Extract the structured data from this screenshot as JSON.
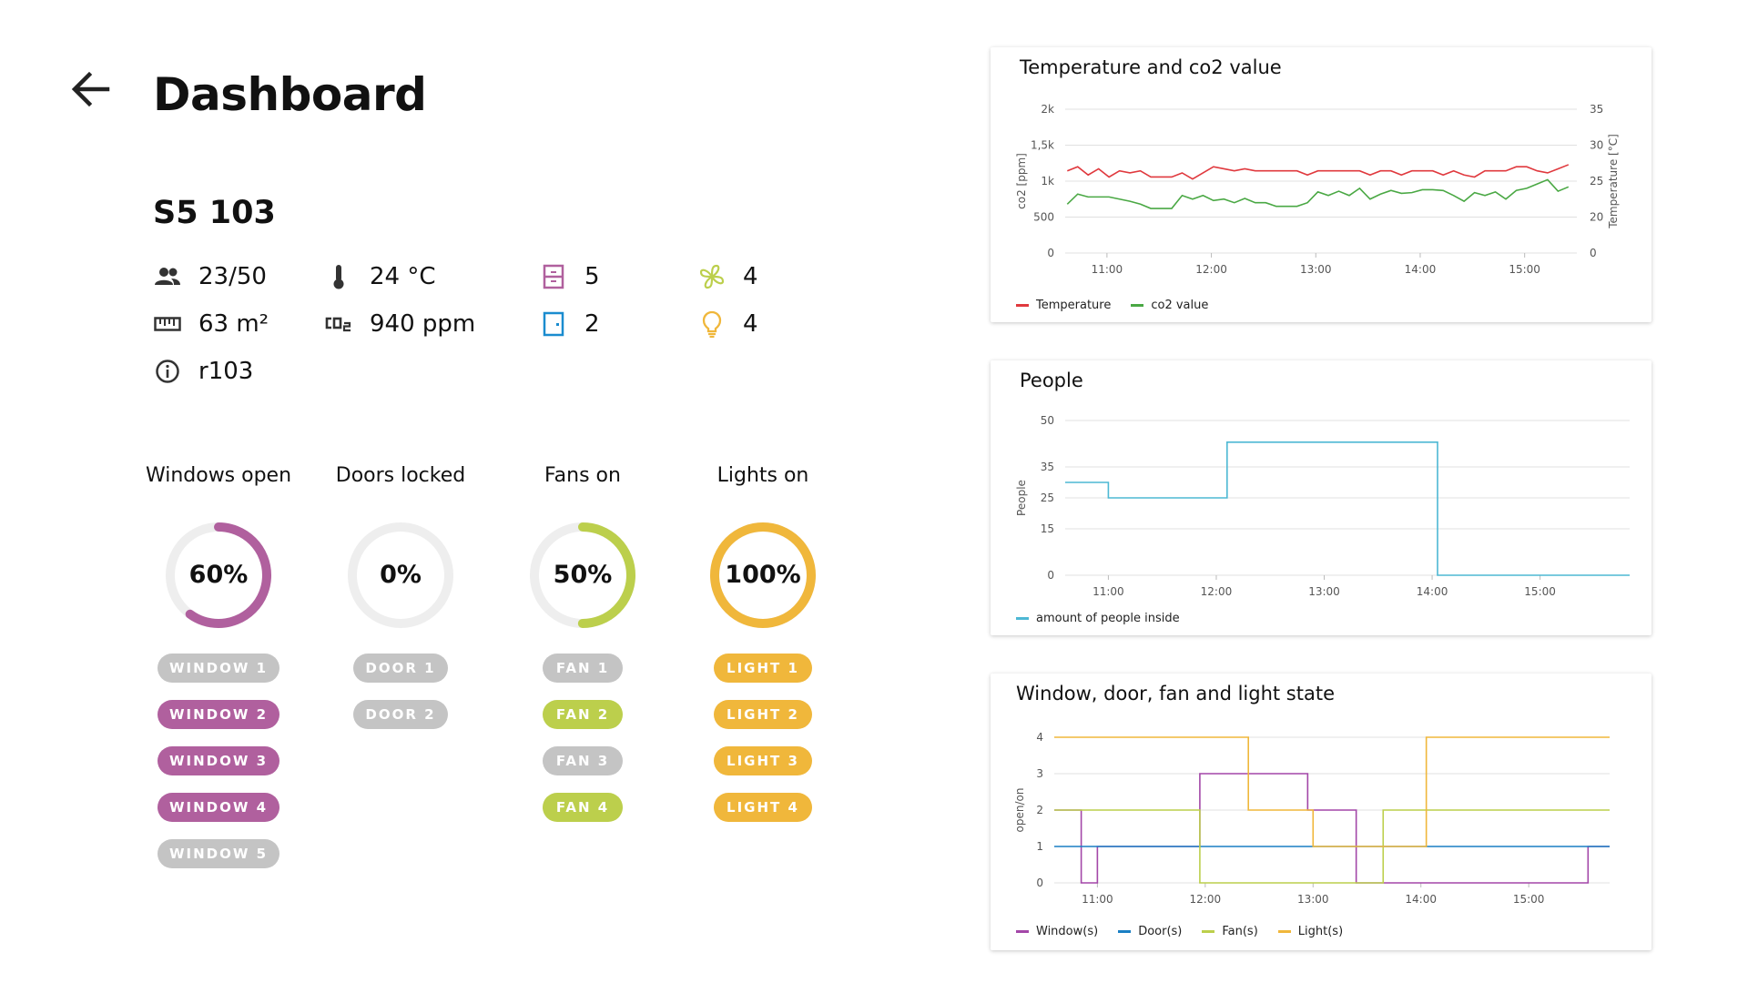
{
  "header": {
    "title": "Dashboard",
    "back_icon": "arrow-left-icon"
  },
  "room": {
    "name": "S5 103",
    "stats": {
      "occupancy": "23/50",
      "temperature": "24 °C",
      "area": "63 m²",
      "co2": "940 ppm",
      "info": "r103",
      "windows_count": "5",
      "doors_count": "2",
      "fans_count": "4",
      "lights_count": "4"
    }
  },
  "colors": {
    "window": "#b0609e",
    "door": "#1a8ccf",
    "fan": "#bccf4c",
    "light": "#f0b73b",
    "off": "#c4c4c4",
    "track": "#eeeeee"
  },
  "rings": [
    {
      "title": "Windows open",
      "value": 0.6,
      "label": "60%",
      "color": "#b0609e"
    },
    {
      "title": "Doors locked",
      "value": 0.0,
      "label": "0%",
      "color": "#c4c4c4"
    },
    {
      "title": "Fans on",
      "value": 0.5,
      "label": "50%",
      "color": "#bccf4c"
    },
    {
      "title": "Lights on",
      "value": 1.0,
      "label": "100%",
      "color": "#f0b73b"
    }
  ],
  "devices": {
    "windows": [
      {
        "label": "WINDOW 1",
        "on": false
      },
      {
        "label": "WINDOW 2",
        "on": true
      },
      {
        "label": "WINDOW 3",
        "on": true
      },
      {
        "label": "WINDOW 4",
        "on": true
      },
      {
        "label": "WINDOW 5",
        "on": false
      }
    ],
    "doors": [
      {
        "label": "DOOR 1",
        "on": false
      },
      {
        "label": "DOOR 2",
        "on": false
      }
    ],
    "fans": [
      {
        "label": "FAN 1",
        "on": false
      },
      {
        "label": "FAN 2",
        "on": true
      },
      {
        "label": "FAN 3",
        "on": false
      },
      {
        "label": "FAN 4",
        "on": true
      }
    ],
    "lights": [
      {
        "label": "LIGHT 1",
        "on": true
      },
      {
        "label": "LIGHT 2",
        "on": true
      },
      {
        "label": "LIGHT 3",
        "on": true
      },
      {
        "label": "LIGHT 4",
        "on": true
      }
    ]
  },
  "chart_data": [
    {
      "type": "line",
      "title": "Temperature and co2 value",
      "ylabel": "co2 [ppm]",
      "y2label": "Temperature [°C]",
      "x_ticks": [
        "11:00",
        "12:00",
        "13:00",
        "14:00",
        "15:00"
      ],
      "xlim": [
        10.6,
        15.5
      ],
      "ylim": [
        0,
        2000
      ],
      "y_ticks": [
        "0",
        "500",
        "1k",
        "1,5k",
        "2k"
      ],
      "y2lim": [
        0,
        35
      ],
      "y2_ticks": [
        "0",
        "20",
        "25",
        "30",
        "35"
      ],
      "legend": "bottom-left",
      "series": [
        {
          "name": "Temperature",
          "axis": "right",
          "color": "#e0393e",
          "x": [
            10.62,
            10.72,
            10.82,
            10.92,
            11.02,
            11.12,
            11.22,
            11.32,
            11.42,
            11.52,
            11.62,
            11.72,
            11.82,
            11.92,
            12.02,
            12.12,
            12.22,
            12.32,
            12.42,
            12.52,
            12.62,
            12.72,
            12.82,
            12.92,
            13.02,
            13.12,
            13.22,
            13.32,
            13.42,
            13.52,
            13.62,
            13.72,
            13.82,
            13.92,
            14.02,
            14.12,
            14.22,
            14.32,
            14.42,
            14.52,
            14.62,
            14.72,
            14.82,
            14.92,
            15.02,
            15.12,
            15.22,
            15.32,
            15.42
          ],
          "y": [
            20,
            21,
            19,
            20.5,
            18.5,
            20,
            19.5,
            20,
            18.5,
            18.5,
            18.5,
            19.5,
            18,
            19.5,
            21,
            20.5,
            20,
            20.5,
            20,
            20,
            20,
            20,
            20,
            19,
            20,
            20,
            20,
            20,
            20,
            19,
            20,
            20,
            19,
            20,
            20,
            20,
            19,
            20,
            19,
            18.5,
            20,
            20,
            20,
            21,
            21,
            20,
            19.5,
            20.5,
            21.5
          ]
        },
        {
          "name": "co2 value",
          "axis": "left",
          "color": "#4aa844",
          "x": [
            10.62,
            10.72,
            10.82,
            10.92,
            11.02,
            11.12,
            11.22,
            11.32,
            11.42,
            11.52,
            11.62,
            11.72,
            11.82,
            11.92,
            12.02,
            12.12,
            12.22,
            12.32,
            12.42,
            12.52,
            12.62,
            12.72,
            12.82,
            12.92,
            13.02,
            13.12,
            13.22,
            13.32,
            13.42,
            13.52,
            13.62,
            13.72,
            13.82,
            13.92,
            14.02,
            14.12,
            14.22,
            14.32,
            14.42,
            14.52,
            14.62,
            14.72,
            14.82,
            14.92,
            15.02,
            15.12,
            15.22,
            15.32,
            15.42
          ],
          "y": [
            680,
            820,
            780,
            780,
            780,
            750,
            720,
            680,
            620,
            620,
            620,
            800,
            750,
            800,
            730,
            750,
            700,
            760,
            700,
            700,
            650,
            650,
            650,
            700,
            850,
            800,
            860,
            800,
            900,
            750,
            820,
            870,
            830,
            840,
            880,
            880,
            870,
            800,
            720,
            840,
            800,
            850,
            750,
            870,
            900,
            960,
            1020,
            860,
            920
          ]
        }
      ]
    },
    {
      "type": "line",
      "title": "People",
      "ylabel": "People",
      "x_ticks": [
        "11:00",
        "12:00",
        "13:00",
        "14:00",
        "15:00"
      ],
      "xlim": [
        10.6,
        15.83
      ],
      "ylim": [
        0,
        50
      ],
      "y_ticks": [
        "0",
        "15",
        "25",
        "35",
        "50"
      ],
      "legend": "bottom-left",
      "series": [
        {
          "name": "amount of people inside",
          "color": "#4db8d4",
          "step": true,
          "x": [
            10.6,
            11.0,
            12.1,
            14.05,
            15.83
          ],
          "y": [
            30,
            25,
            43,
            0,
            0
          ]
        }
      ]
    },
    {
      "type": "line",
      "title": "Window, door, fan and light state",
      "ylabel": "open/on",
      "x_ticks": [
        "11:00",
        "12:00",
        "13:00",
        "14:00",
        "15:00"
      ],
      "xlim": [
        10.6,
        15.75
      ],
      "ylim": [
        0,
        4
      ],
      "y_ticks": [
        "0",
        "1",
        "2",
        "3",
        "4"
      ],
      "legend": "bottom-left",
      "series": [
        {
          "name": "Window(s)",
          "color": "#a347a8",
          "step": true,
          "x": [
            10.6,
            10.85,
            11.0,
            11.95,
            12.95,
            13.4,
            13.65,
            14.0,
            15.55,
            15.75
          ],
          "y": [
            2,
            0,
            1,
            3,
            2,
            0,
            0,
            0,
            1,
            1
          ]
        },
        {
          "name": "Door(s)",
          "color": "#1a7fc4",
          "step": true,
          "x": [
            10.6,
            15.75
          ],
          "y": [
            1,
            1
          ]
        },
        {
          "name": "Fan(s)",
          "color": "#bccf4c",
          "step": true,
          "x": [
            10.6,
            11.95,
            13.65,
            15.75
          ],
          "y": [
            2,
            0,
            2,
            2
          ]
        },
        {
          "name": "Light(s)",
          "color": "#f0b73b",
          "step": true,
          "x": [
            10.6,
            12.4,
            13.0,
            14.05,
            15.75
          ],
          "y": [
            4,
            2,
            1,
            4,
            4
          ]
        }
      ]
    }
  ]
}
